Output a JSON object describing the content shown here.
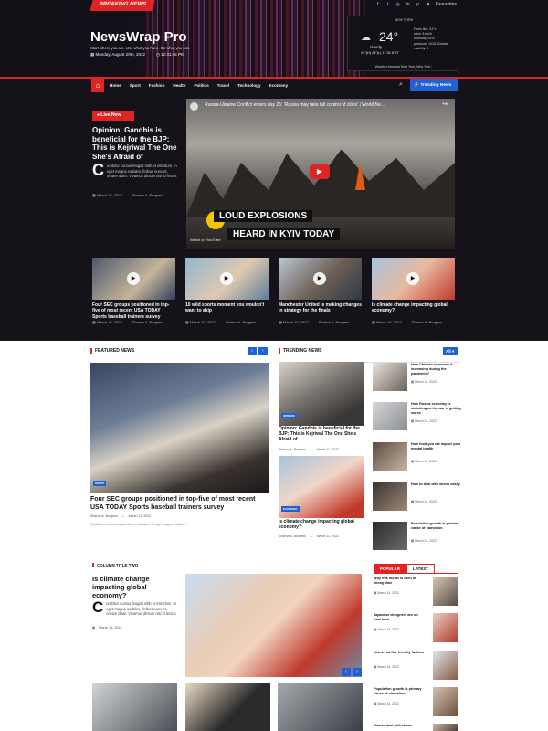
{
  "header": {
    "breaking_label": "BREAKING NEWS",
    "favourites": "Favourites",
    "logo": "NewsWrap Pro",
    "tagline": "Start where you are. Use what you have. Do what you can.",
    "date": "Monday, August 29th, 2022",
    "time": "12:31:46 PM",
    "social_icons": [
      "facebook-icon",
      "twitter-icon",
      "instagram-icon",
      "linkedin-icon",
      "pinterest-icon"
    ]
  },
  "weather": {
    "city": "NEW YORK",
    "temp": "24°",
    "condition": "cloudy",
    "hilo": "24°(H) 24°(L) 17:31 EDT",
    "details": [
      "Feels like: 24°c",
      "wind: 8 km/h",
      "humidity: 53%",
      "pressure: 1015.32mbar",
      "visibility: 0"
    ],
    "footer": "Weather forecast New York, New York ›"
  },
  "nav": {
    "items": [
      "Home",
      "Sport",
      "Fashion",
      "Health",
      "Politics",
      "Travel",
      "Technology",
      "Economy"
    ],
    "trending": "Trending News"
  },
  "hero": {
    "live_label": "Live Now",
    "headline": "Opinion: Gandhis is beneficial for the BJP: This is Kejriwal The One She's Afraid of",
    "drop_cap": "C",
    "excerpt": "urabitur cursus feugiat nibh et interdum. In eget magna sodales, finibus nunc et, ornare diam. Vivamus dictum nisl id lectus",
    "date": "March 15, 2022",
    "author": "Sharna A. Burgess"
  },
  "video": {
    "title": "Russia-Ukraine Conflict enters day 26: 'Russia may take full control of cities' | World Ne...",
    "caption1": "LOUD EXPLOSIONS",
    "caption2": "HEARD IN KYIV TODAY",
    "watch_on": "Watch on YouTube"
  },
  "thumbs": [
    {
      "title": "Four SEC groups positioned in top-five of most recent USA TODAY Sports baseball trainers survey",
      "date": "March 15, 2022",
      "author": "Sharna A. Burgess"
    },
    {
      "title": "10 wild sports moment you wouldn't want to skip",
      "date": "March 15, 2022",
      "author": "Sharna A. Burgess"
    },
    {
      "title": "Manchester United is making changes in strategy for the finals",
      "date": "March 15, 2022",
      "author": "Sharna A. Burgess"
    },
    {
      "title": "Is climate change impacting global economy?",
      "date": "March 15, 2022",
      "author": "Sharna A. Burgess"
    }
  ],
  "featured": {
    "label": "FEATURED NEWS",
    "badge": "SPORT",
    "title": "Four SEC groups positioned in top-five of most recent USA TODAY Sports baseball trainers survey",
    "author": "Sharna A. Burgess",
    "date": "March 11, 2022",
    "excerpt": "Curabitur cursus feugiat nibh et interdum. In eget magna sodales..."
  },
  "trending": {
    "label": "TRENDING NEWS",
    "filter": "All",
    "cards": [
      {
        "badge": "OPINION",
        "title": "Opinion: Gandhis is beneficial for the BJP: This is Kejriwal The One She's Afraid of",
        "author": "Sharna A. Burgess",
        "date": "March 11, 2022"
      },
      {
        "badge": "ECONOMY",
        "title": "Is climate change impacting global economy?",
        "author": "Sharna A. Burgess",
        "date": "March 11, 2022"
      }
    ],
    "side": [
      {
        "title": "How Chinese economy is increasing during the pandemic?",
        "date": "March 15, 2022"
      },
      {
        "title": "How Russia economy is shrinking as the war is getting worse",
        "date": "March 14, 2022"
      },
      {
        "title": "How food you eat impact your mental health",
        "date": "March 14, 2022"
      },
      {
        "title": "How to deal with stress easily",
        "date": "March 14, 2022"
      },
      {
        "title": "Population growth is primary cause of starvation",
        "date": "March 14, 2022"
      }
    ]
  },
  "column_two": {
    "label": "COLUMN TITLE TWO",
    "title": "Is climate change impacting global economy?",
    "drop_cap": "C",
    "excerpt": "urabitur cursus feugiat nibh et interdum. In eget magna sodales, finibus nunc et, ornare diam. Vivamus dictum nisl id lectus",
    "date": "March 15, 2022"
  },
  "popular": {
    "tab_popular": "POPULAR",
    "tab_latest": "LATEST",
    "items": [
      {
        "title": "Why this model is born in wrong time",
        "date": "March 14, 2022"
      },
      {
        "title": "Japanese designers are on next level",
        "date": "March 14, 2022"
      },
      {
        "title": "New trend like friendly fashion",
        "date": "March 14, 2022"
      },
      {
        "title": "Population growth is primary cause of starvation",
        "date": "March 14, 2022"
      },
      {
        "title": "How to deal with stress",
        "date": ""
      }
    ]
  },
  "colors": {
    "accent": "#e02424",
    "blue": "#1f62d6",
    "dark": "#15121a"
  }
}
